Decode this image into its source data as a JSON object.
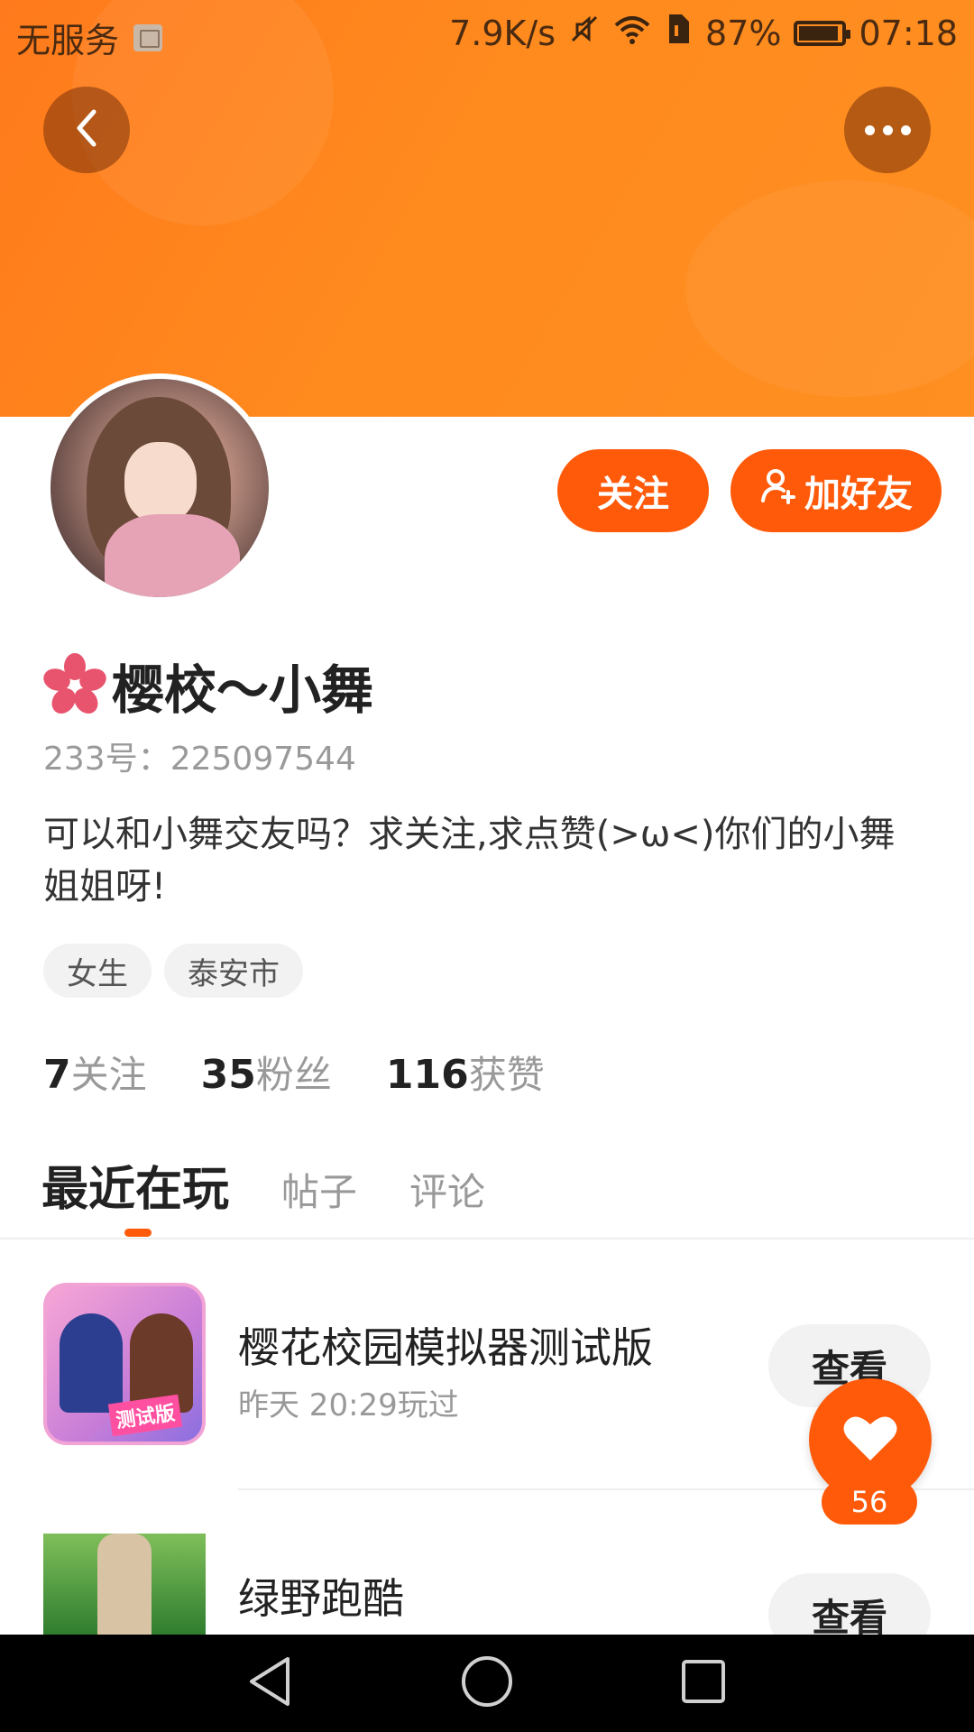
{
  "status_bar": {
    "carrier": "无服务",
    "net_speed": "7.9K/s",
    "battery": "87%",
    "time": "07:18"
  },
  "header": {
    "back_icon": "chevron-left-icon",
    "more_icon": "more-dots-icon"
  },
  "profile": {
    "name_icon": "sakura-flower-icon",
    "name": "樱校～小舞",
    "id_text": "233号：225097544",
    "bio": "可以和小舞交友吗？求关注,求点赞(>ω<)你们的小舞姐姐呀!",
    "tags": [
      "女生",
      "泰安市"
    ],
    "follow_button": "关注",
    "add_friend_button": "加好友",
    "accent_color": "#ff5a0a"
  },
  "stats": [
    {
      "num": "7",
      "label": "关注"
    },
    {
      "num": "35",
      "label": "粉丝"
    },
    {
      "num": "116",
      "label": "获赞"
    }
  ],
  "tabs": [
    {
      "label": "最近在玩",
      "active": true
    },
    {
      "label": "帖子",
      "active": false
    },
    {
      "label": "评论",
      "active": false
    }
  ],
  "games": [
    {
      "title": "樱花校园模拟器测试版",
      "subtitle": "昨天 20:29玩过",
      "icon_badge": "测试版",
      "button": "查看"
    },
    {
      "title": "绿野跑酷",
      "subtitle": "",
      "button": "查看"
    }
  ],
  "like": {
    "count": "56",
    "icon": "heart-icon"
  },
  "nav": {
    "back": "nav-back-icon",
    "home": "nav-home-icon",
    "recents": "nav-recents-icon"
  }
}
